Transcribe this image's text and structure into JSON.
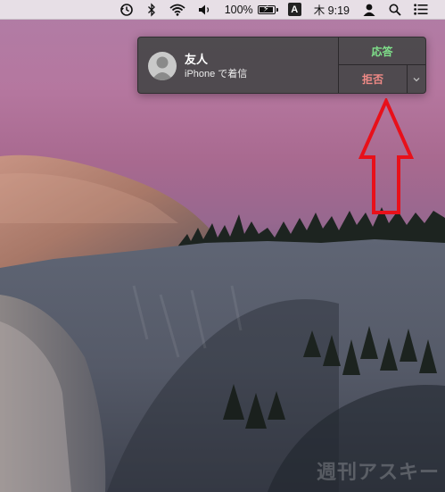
{
  "menubar": {
    "battery_percent": "100%",
    "battery_level": 1.0,
    "input_source": "A",
    "clock": "木 9:19",
    "icons": [
      "time-machine-icon",
      "bluetooth-icon",
      "wifi-icon",
      "volume-icon",
      "battery-icon",
      "input-source-icon",
      "user-icon",
      "spotlight-icon",
      "notification-center-icon"
    ]
  },
  "notification": {
    "title": "友人",
    "subtitle": "iPhone で着信",
    "accept_label": "応答",
    "decline_label": "拒否",
    "more_icon": "chevron-down-icon",
    "avatar_icon": "person-icon",
    "colors": {
      "accept": "#7fe08a",
      "decline": "#f08a86",
      "background": "#464648"
    }
  },
  "annotation": {
    "arrow_color": "#e8101a",
    "arrow_icon": "up-arrow-icon"
  },
  "watermark": {
    "text": "週刊アスキー"
  }
}
